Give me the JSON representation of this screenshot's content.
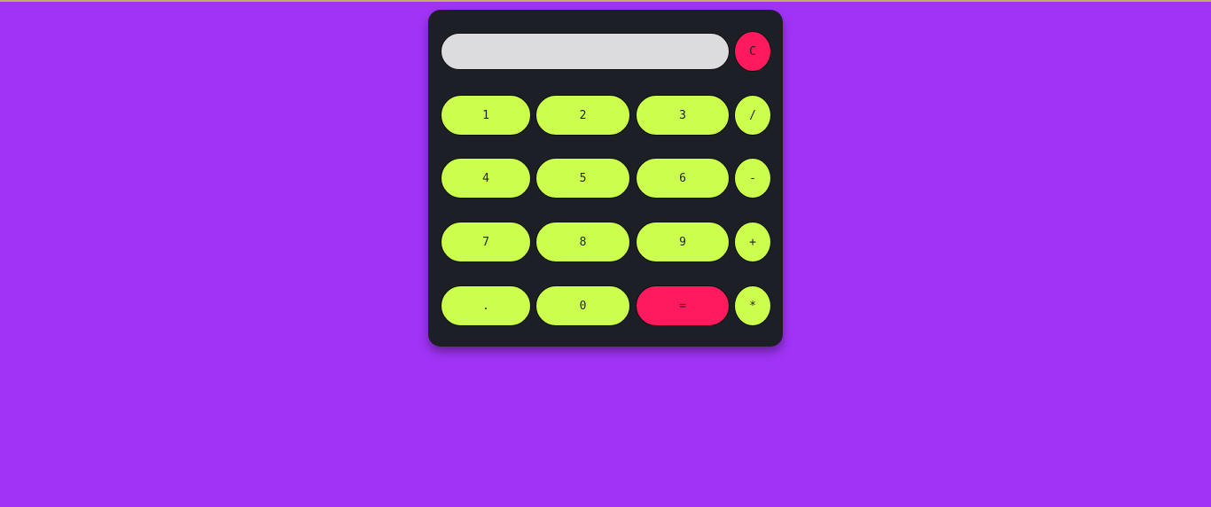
{
  "display": {
    "value": "",
    "placeholder": ""
  },
  "buttons": {
    "clear": "C",
    "one": "1",
    "two": "2",
    "three": "3",
    "divide": "/",
    "four": "4",
    "five": "5",
    "six": "6",
    "subtract": "-",
    "seven": "7",
    "eight": "8",
    "nine": "9",
    "add": "+",
    "decimal": ".",
    "zero": "0",
    "equals": "=",
    "multiply": "*"
  },
  "colors": {
    "background": "#a033f5",
    "calculator": "#1d1f27",
    "display": "#dcdbde",
    "key": "#ccff4d",
    "accent": "#ff1a5e"
  }
}
